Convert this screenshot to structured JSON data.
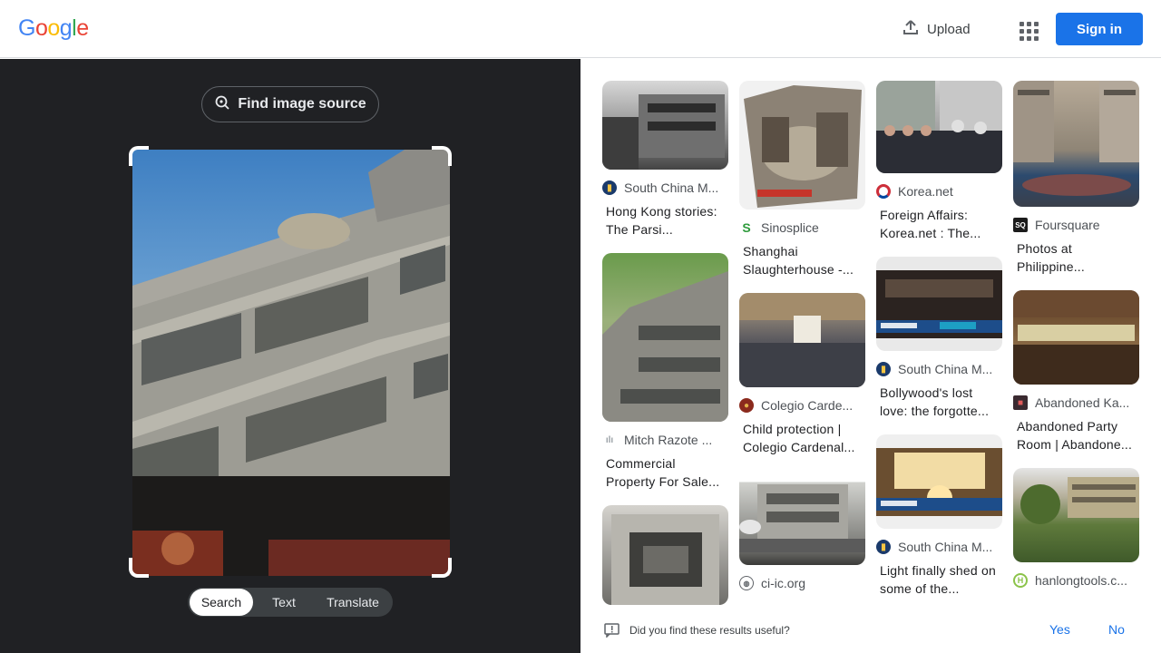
{
  "header": {
    "logo_letters": [
      {
        "ch": "G",
        "color": "#4285F4"
      },
      {
        "ch": "o",
        "color": "#EA4335"
      },
      {
        "ch": "o",
        "color": "#FBBC05"
      },
      {
        "ch": "g",
        "color": "#4285F4"
      },
      {
        "ch": "l",
        "color": "#34A853"
      },
      {
        "ch": "e",
        "color": "#EA4335"
      }
    ],
    "upload_label": "Upload",
    "apps_icon": "apps-grid-icon",
    "signin_label": "Sign in"
  },
  "lens": {
    "find_source_label": "Find image source",
    "modes": [
      "Search",
      "Text",
      "Translate"
    ],
    "active_mode": "Search"
  },
  "results": {
    "columns": [
      [
        {
          "source": "South China M...",
          "title": "Hong Kong stories: The Parsi...",
          "favicon": "scmp-icon",
          "thumb": "bw-building"
        },
        {
          "source": "Mitch Razote ...",
          "title": "Commercial Property For Sale...",
          "favicon": "chart-icon",
          "thumb": "building-trees"
        },
        {
          "source": "",
          "title": "",
          "favicon": "",
          "thumb": "aerial-model"
        }
      ],
      [
        {
          "source": "Sinosplice",
          "title": "Shanghai Slaughterhouse -...",
          "favicon": "s-logo-icon",
          "thumb": "collage-interior"
        },
        {
          "source": "Colegio Carde...",
          "title": "Child protection | Colegio Cardenal...",
          "favicon": "crest-icon",
          "thumb": "crowd-hall"
        },
        {
          "source": "ci-ic.org",
          "title": "",
          "favicon": "globe-icon",
          "thumb": "street-building"
        }
      ],
      [
        {
          "source": "Korea.net",
          "title": "Foreign Affairs: Korea.net : The...",
          "favicon": "korea-flag-icon",
          "thumb": "group-photo"
        },
        {
          "source": "South China M...",
          "title": "Bollywood's lost love: the forgotte...",
          "favicon": "scmp-icon",
          "thumb": "ballroom"
        },
        {
          "source": "South China M...",
          "title": "Light finally shed on some of the...",
          "favicon": "scmp-icon",
          "thumb": "sunlit-room"
        }
      ],
      [
        {
          "source": "Foursquare",
          "title": "Photos at Philippine...",
          "favicon": "foursquare-icon",
          "thumb": "courtyard"
        },
        {
          "source": "Abandoned Ka...",
          "title": "Abandoned Party Room | Abandone...",
          "favicon": "abandoned-icon",
          "thumb": "party-room"
        },
        {
          "source": "hanlongtools.c...",
          "title": "",
          "favicon": "hanlong-icon",
          "thumb": "garden-building"
        }
      ]
    ]
  },
  "feedback": {
    "question": "Did you find these results useful?",
    "yes_label": "Yes",
    "no_label": "No"
  }
}
